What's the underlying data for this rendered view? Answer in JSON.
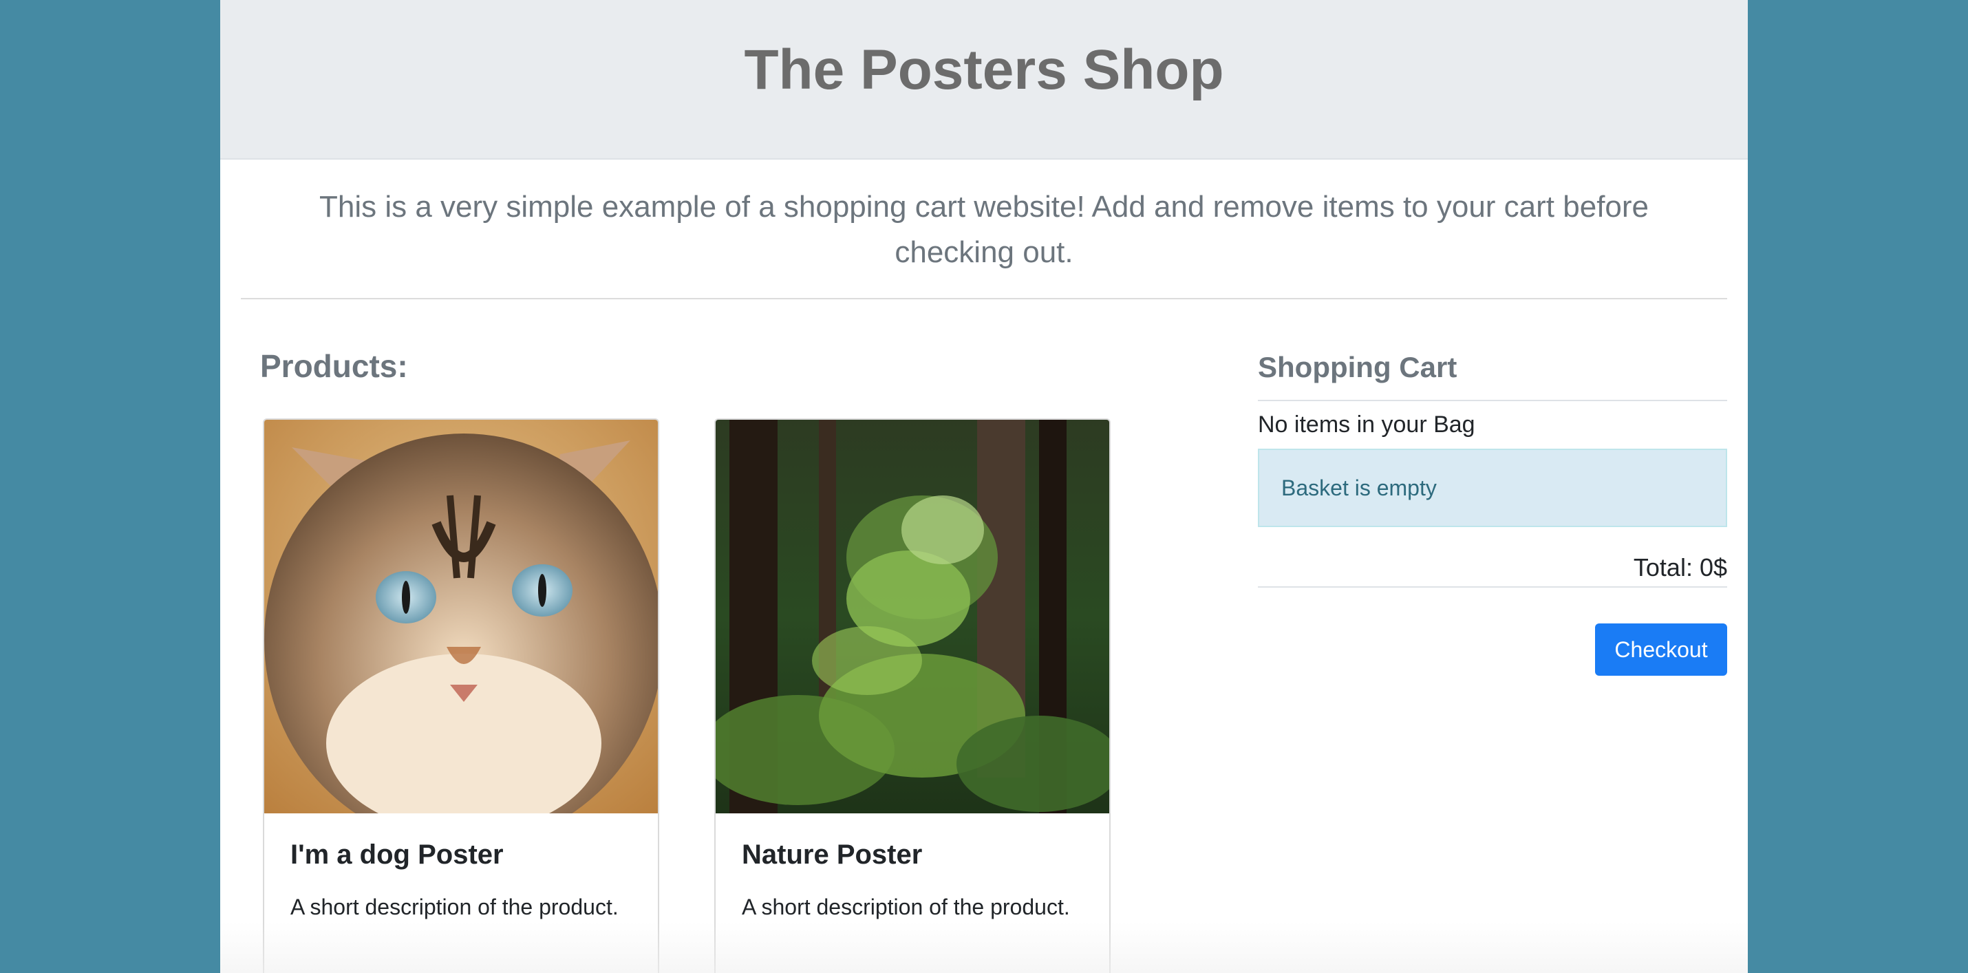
{
  "header": {
    "title": "The Posters Shop"
  },
  "intro": {
    "lead": "This is a very simple example of a shopping cart website! Add and remove items to your cart before checking out."
  },
  "products": {
    "heading": "Products:",
    "items": [
      {
        "title": "I'm a dog Poster",
        "description": "A short description of the product.",
        "image": "cat-photo"
      },
      {
        "title": "Nature Poster",
        "description": "A short description of the product.",
        "image": "forest-photo"
      }
    ]
  },
  "cart": {
    "heading": "Shopping Cart",
    "status_text": "No items in your Bag",
    "alert_text": "Basket is empty",
    "total_text": "Total: 0$",
    "checkout_label": "Checkout"
  },
  "colors": {
    "page_background": "#458aa3",
    "primary": "#1a7cf5",
    "alert_info_bg": "#d9eaf3"
  }
}
